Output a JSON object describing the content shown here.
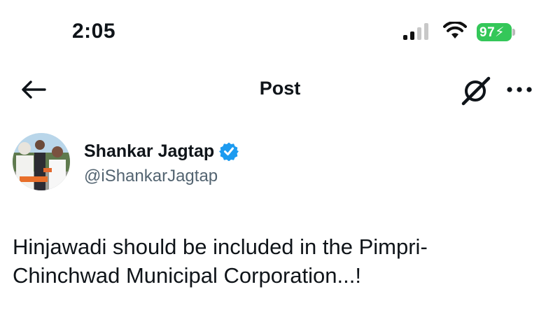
{
  "status_bar": {
    "time": "2:05",
    "battery_level": "97",
    "battery_color": "#34c759",
    "icons": [
      "cellular-signal-icon",
      "wifi-icon",
      "battery-charging-icon"
    ]
  },
  "nav": {
    "title": "Post",
    "icons": [
      "back-arrow-icon",
      "grok-icon",
      "more-icon"
    ]
  },
  "post": {
    "author_name": "Shankar Jagtap",
    "author_handle": "@iShankarJagtap",
    "verified_color": "#1d9bf0",
    "text_line_1": "Hinjawadi should be included in the Pimpri-",
    "text_line_2": "Chinchwad Municipal Corporation...!"
  }
}
